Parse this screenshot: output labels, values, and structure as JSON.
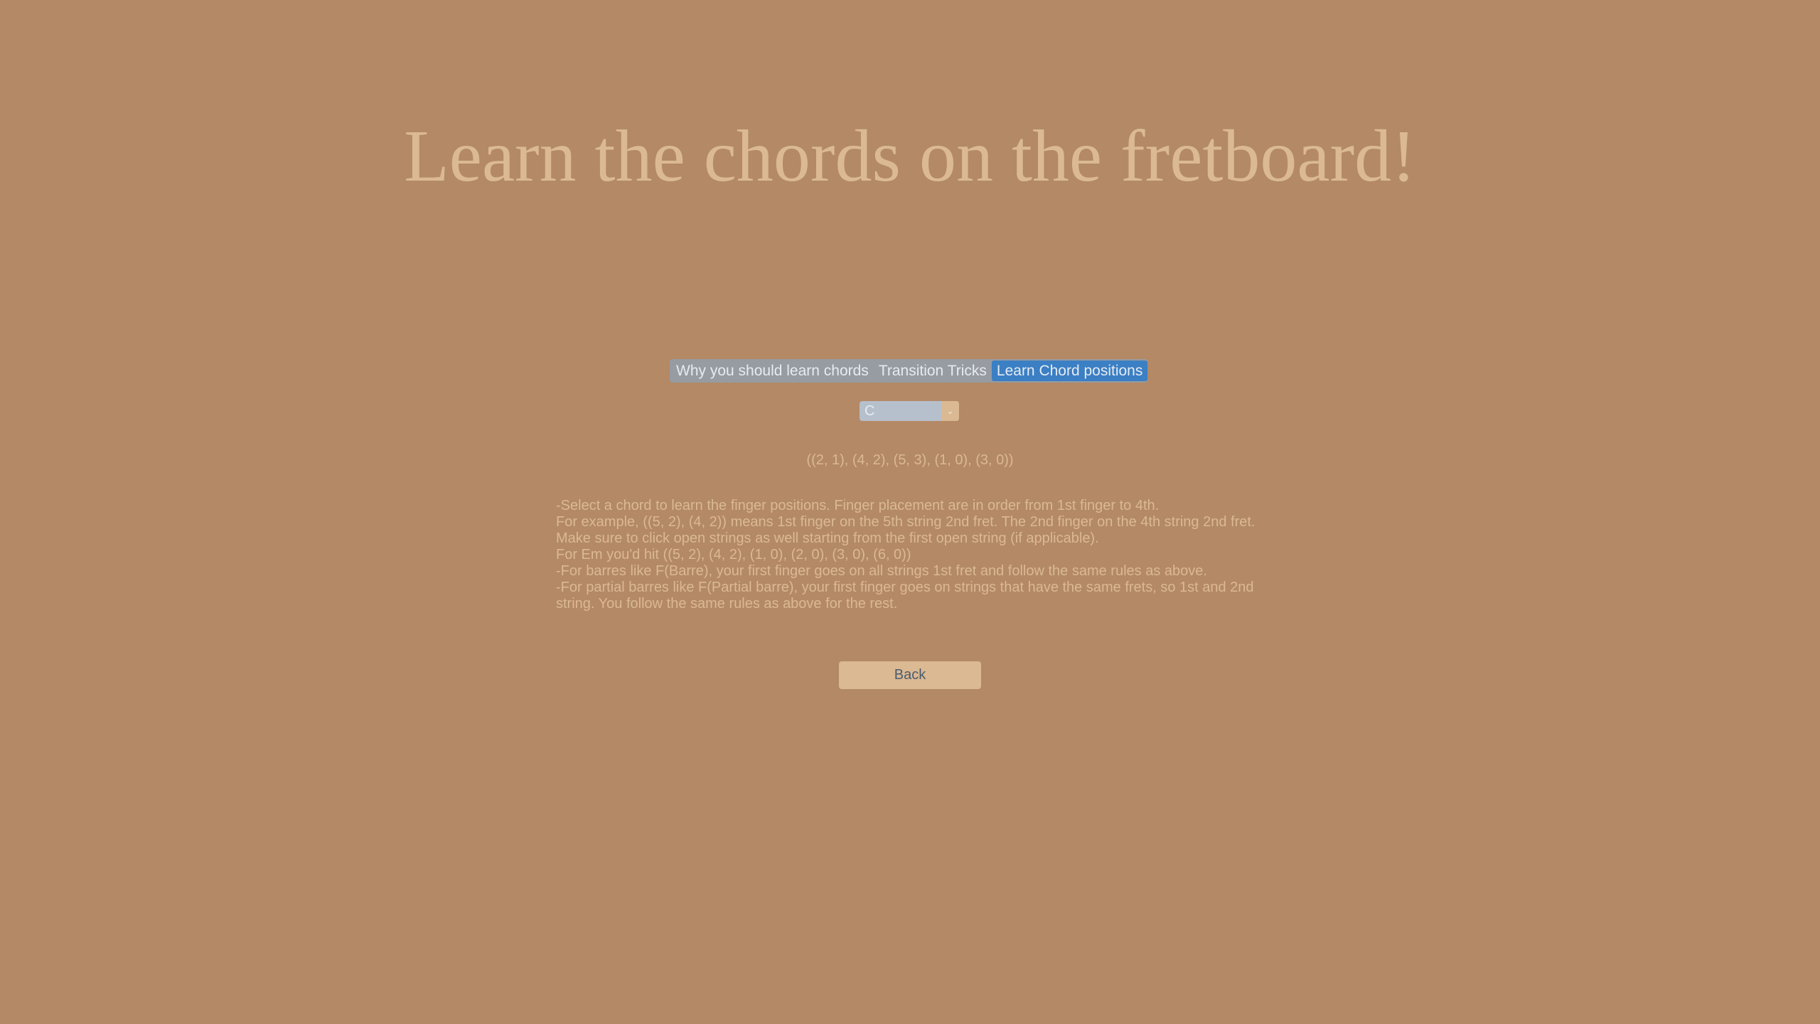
{
  "header": {
    "title": "Learn the chords on the fretboard!"
  },
  "tabs": [
    {
      "label": "Why you should learn chords",
      "active": false
    },
    {
      "label": "Transition Tricks",
      "active": false
    },
    {
      "label": "Learn Chord positions",
      "active": true
    }
  ],
  "chord_select": {
    "value": "C",
    "icon": "chevron-down-icon"
  },
  "chord_positions": "((2, 1), (4, 2), (5, 3), (1, 0), (3, 0))",
  "instructions": [
    "-Select a chord to learn the finger positions. Finger placement are in order from 1st finger to 4th.",
    "For example, ((5, 2), (4, 2)) means 1st finger on the 5th string 2nd fret. The 2nd finger on the 4th string 2nd fret.",
    "Make sure to click open strings as well starting from the first open string (if applicable).",
    "For Em you'd hit ((5, 2), (4, 2), (1, 0), (2, 0), (3, 0), (6, 0))",
    "-For barres like F(Barre), your first finger goes on all strings 1st fret and follow the same rules as above.",
    "-For partial barres like F(Partial barre), your first finger goes on strings that have the same frets, so 1st and 2nd string. You follow the same rules as above for the rest."
  ],
  "back_label": "Back",
  "colors": {
    "background": "#b38966",
    "title": "#dbb993",
    "active_tab": "#3b7fc4",
    "tab_bar": "#979ba2"
  }
}
